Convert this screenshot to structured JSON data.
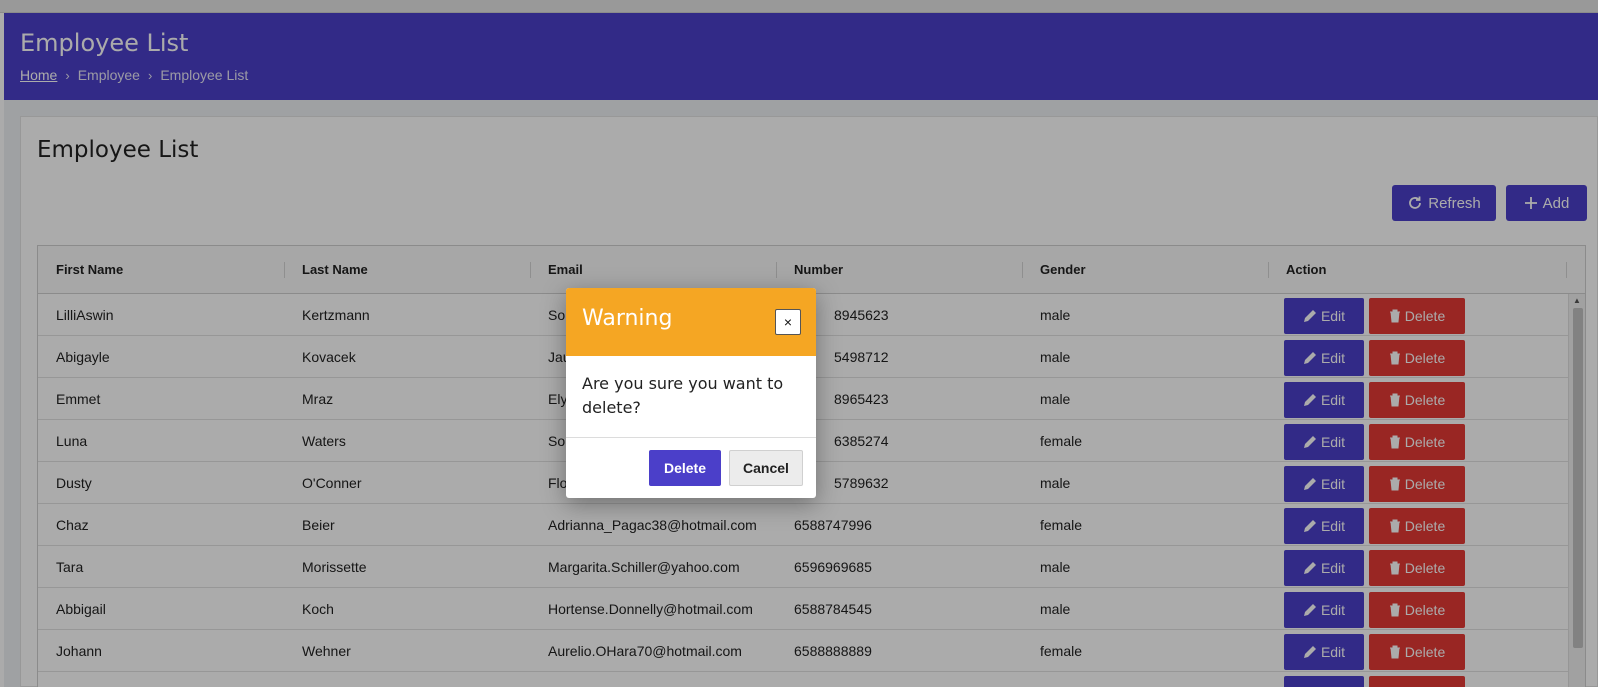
{
  "header": {
    "title": "Employee List",
    "breadcrumb": [
      "Home",
      "Employee",
      "Employee List"
    ]
  },
  "card": {
    "title": "Employee List",
    "refresh_label": "Refresh",
    "add_label": "Add"
  },
  "table": {
    "columns": [
      "First Name",
      "Last Name",
      "Email",
      "Number",
      "Gender",
      "Action"
    ],
    "edit_label": "Edit",
    "delete_label": "Delete",
    "rows": [
      {
        "first": "LilliAswin",
        "last": "Kertzmann",
        "email": "Sol",
        "number": "8945623",
        "gender": "male"
      },
      {
        "first": "Abigayle",
        "last": "Kovacek",
        "email": "Jau",
        "number": "5498712",
        "gender": "male"
      },
      {
        "first": "Emmet",
        "last": "Mraz",
        "email": "Ely",
        "number": "8965423",
        "gender": "male"
      },
      {
        "first": "Luna",
        "last": "Waters",
        "email": "Sor",
        "number": "6385274",
        "gender": "female"
      },
      {
        "first": "Dusty",
        "last": "O'Conner",
        "email": "Flo",
        "number": "5789632",
        "gender": "male"
      },
      {
        "first": "Chaz",
        "last": "Beier",
        "email": "Adrianna_Pagac38@hotmail.com",
        "number": "6588747996",
        "gender": "female"
      },
      {
        "first": "Tara",
        "last": "Morissette",
        "email": "Margarita.Schiller@yahoo.com",
        "number": "6596969685",
        "gender": "male"
      },
      {
        "first": "Abbigail",
        "last": "Koch",
        "email": "Hortense.Donnelly@hotmail.com",
        "number": "6588784545",
        "gender": "male"
      },
      {
        "first": "Johann",
        "last": "Wehner",
        "email": "Aurelio.OHara70@hotmail.com",
        "number": "6588888889",
        "gender": "female"
      }
    ]
  },
  "modal": {
    "title": "Warning",
    "close_label": "×",
    "message": "Are you sure you want to delete?",
    "delete_label": "Delete",
    "cancel_label": "Cancel"
  },
  "colors": {
    "primary": "#4b3fc9",
    "danger": "#e53935",
    "warning": "#f5a623"
  },
  "icons": {
    "refresh": "refresh-icon",
    "add": "plus-icon",
    "edit": "pencil-icon",
    "delete": "trash-icon"
  }
}
